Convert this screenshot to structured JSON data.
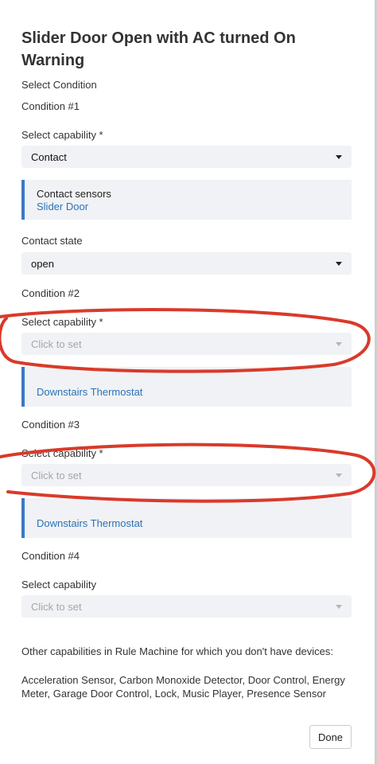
{
  "title": "Slider Door Open with AC turned On Warning",
  "select_condition": "Select Condition",
  "conditions": [
    {
      "heading": "Condition #1",
      "capability_label": "Select capability *",
      "capability_value": "Contact",
      "device_card_title": "Contact sensors",
      "device_card_link": "Slider Door",
      "state_label": "Contact state",
      "state_value": "open"
    },
    {
      "heading": "Condition #2",
      "capability_label": "Select capability *",
      "capability_placeholder": "Click to set",
      "device_card_link": "Downstairs Thermostat"
    },
    {
      "heading": "Condition #3",
      "capability_label": "Select capability *",
      "capability_placeholder": "Click to set",
      "device_card_link": "Downstairs Thermostat"
    },
    {
      "heading": "Condition #4",
      "capability_label": "Select capability",
      "capability_placeholder": "Click to set"
    }
  ],
  "other_capabilities_intro": "Other capabilities in Rule Machine for which you don't have devices:",
  "other_capabilities_list": "Acceleration Sensor, Carbon Monoxide Detector, Door Control, Energy Meter, Garage Door Control, Lock, Music Player, Presence Sensor",
  "done_label": "Done",
  "colors": {
    "accent_bar": "#3a79c7",
    "link": "#2b72b8",
    "annotation_ellipse": "#d93a2b"
  },
  "icons": [
    "caret-down-icon"
  ]
}
